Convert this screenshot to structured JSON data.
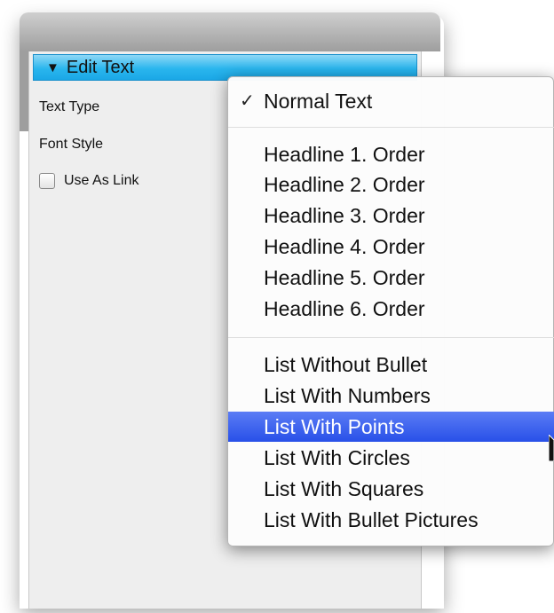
{
  "panel": {
    "header": {
      "title": "Edit Text",
      "triangle": "▼"
    },
    "fields": {
      "text_type_label": "Text Type",
      "font_style_label": "Font Style",
      "use_as_link_label": "Use As Link",
      "use_as_link_checked": false
    }
  },
  "menu": {
    "checkmark": "✓",
    "selected_value": "Normal Text",
    "highlighted_item": "List With Points",
    "groups": [
      [
        "Normal Text"
      ],
      [
        "Headline 1. Order",
        "Headline 2. Order",
        "Headline 3. Order",
        "Headline 4. Order",
        "Headline 5. Order",
        "Headline 6. Order"
      ],
      [
        "List Without Bullet",
        "List With Numbers",
        "List With Points",
        "List With Circles",
        "List With Squares",
        "List With Bullet Pictures"
      ]
    ],
    "items": {
      "normal": "Normal Text",
      "h1": "Headline 1. Order",
      "h2": "Headline 2. Order",
      "h3": "Headline 3. Order",
      "h4": "Headline 4. Order",
      "h5": "Headline 5. Order",
      "h6": "Headline 6. Order",
      "list_without_bullet": "List Without Bullet",
      "list_with_numbers": "List With Numbers",
      "list_with_points": "List With Points",
      "list_with_circles": "List With Circles",
      "list_with_squares": "List With Squares",
      "list_with_bullet_pictures": "List With Bullet Pictures"
    }
  },
  "colors": {
    "header_accent": "#2ab6ee",
    "selection": "#3a62ee"
  }
}
